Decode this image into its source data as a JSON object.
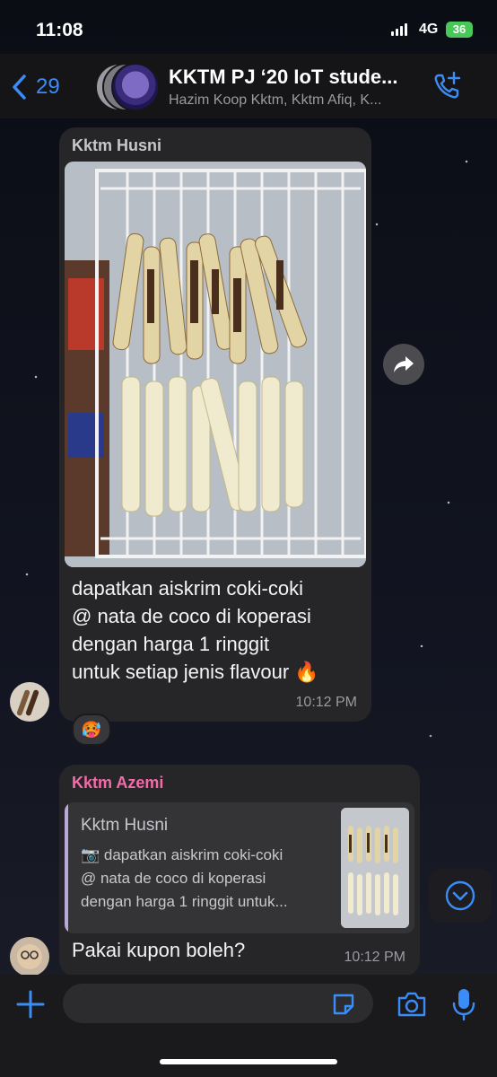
{
  "status": {
    "time": "11:08",
    "network": "4G",
    "battery": "36"
  },
  "header": {
    "back_count": "29",
    "title": "KKTM PJ ‘20 IoT stude...",
    "subtitle": "Hazim Koop Kktm, Kktm Afiq, K..."
  },
  "messages": [
    {
      "sender": "Kktm Husni",
      "sender_color": "#c7c7cc",
      "text": "dapatkan aiskrim coki-coki\n@ nata de coco di koperasi\ndengan harga 1 ringgit\nuntuk setiap jenis flavour 🔥",
      "time": "10:12 PM",
      "reaction": "🥵"
    },
    {
      "sender": "Kktm Azemi",
      "sender_color": "#f36ba8",
      "quote_sender": "Kktm Husni",
      "quote_text": "📷 dapatkan aiskrim coki-coki\n@ nata de coco di koperasi\ndengan harga 1 ringgit untuk...",
      "text": "Pakai kupon boleh?",
      "time": "10:12 PM"
    }
  ],
  "colors": {
    "accent": "#3b8cf7",
    "bubble": "#262628"
  },
  "icons": {
    "back": "chevron-left-icon",
    "call": "add-call-icon",
    "forward": "forward-icon",
    "scroll": "chevron-down-icon",
    "plus": "plus-icon",
    "sticker": "sticker-icon",
    "camera": "camera-icon",
    "mic": "microphone-icon"
  }
}
